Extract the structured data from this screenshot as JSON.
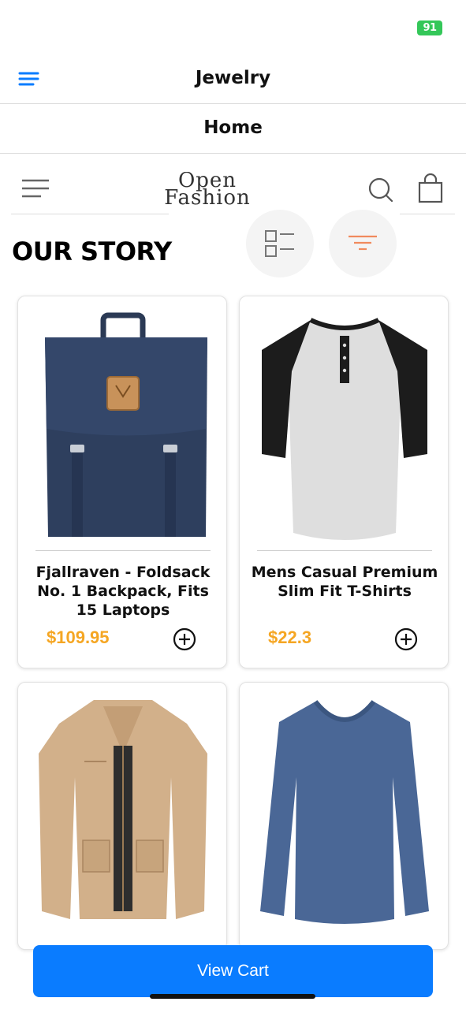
{
  "status_bar": {
    "battery_level": "91"
  },
  "nav_bar": {
    "title": "Jewelry"
  },
  "home_bar": {
    "title": "Home"
  },
  "app_header": {
    "logo_line1": "Open",
    "logo_line2": "Fashion"
  },
  "section": {
    "title": "OUR STORY"
  },
  "products": [
    {
      "title": "Fjallraven - Foldsack No. 1 Backpack, Fits 15 Laptops",
      "price": "$109.95",
      "image": "navy-backpack"
    },
    {
      "title": "Mens Casual Premium Slim Fit T-Shirts",
      "price": "$22.3",
      "image": "raglan-henley-shirt"
    },
    {
      "title": "",
      "price": "",
      "image": "khaki-jacket"
    },
    {
      "title": "",
      "price": "",
      "image": "blue-long-sleeve-tee"
    }
  ],
  "cart": {
    "button_label": "View Cart"
  },
  "colors": {
    "accent": "#0a7cff",
    "price": "#f5a623",
    "battery": "#34c759",
    "filter_icon": "#f08a5d"
  },
  "icons": [
    "menu-icon",
    "hamburger-icon",
    "search-icon",
    "shopping-bag-icon",
    "list-layout-icon",
    "filter-icon",
    "add-circle-icon"
  ]
}
